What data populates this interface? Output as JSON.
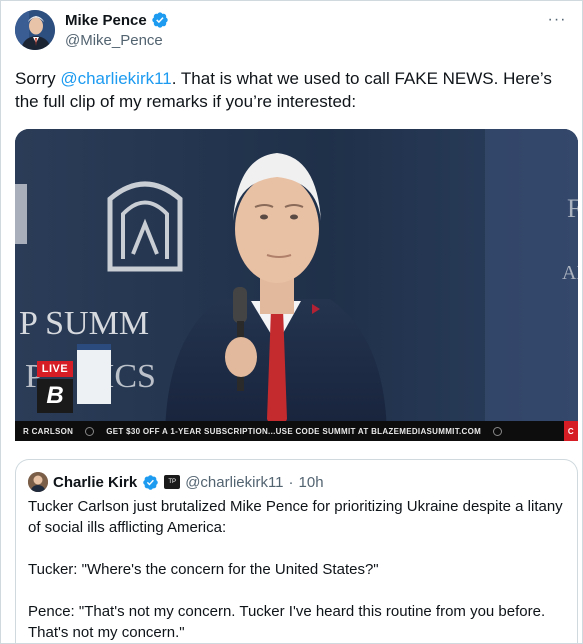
{
  "tweet": {
    "author": {
      "display_name": "Mike Pence",
      "handle": "@Mike_Pence",
      "verified": true
    },
    "text_before_mention": "Sorry ",
    "mention": "@charliekirk11",
    "text_after_mention": ". That is what we used to call FAKE NEWS. Here’s the full clip of my remarks if you’re interested:",
    "more_label": "···"
  },
  "video": {
    "backdrop_text_1": "P SUMM",
    "backdrop_text_2": "P",
    "backdrop_text_3": "ICS",
    "live_label": "LIVE",
    "logo_letter": "B",
    "ticker": {
      "name": "R CARLSON",
      "promo": "GET $30 OFF A 1-YEAR SUBSCRIPTION...USE CODE SUMMIT AT BLAZEMEDIASUMMIT.COM"
    }
  },
  "quoted_tweet": {
    "display_name": "Charlie Kirk",
    "handle": "@charliekirk11",
    "time": "10h",
    "paragraphs": [
      "Tucker Carlson just brutalized Mike Pence for prioritizing Ukraine despite a litany of social ills afflicting America:",
      "Tucker: \"Where's the concern for the United States?\"",
      "Pence: \"That's not my concern. Tucker I've heard this routine from you before. That's not my concern.\""
    ]
  },
  "colors": {
    "link": "#1d9bf0",
    "verified": "#1d9bf0",
    "border": "#cfd9de",
    "secondary_text": "#536471",
    "live_red": "#d61c24"
  },
  "icons": [
    "verified-badge-icon",
    "more-options-icon",
    "affiliate-badge-icon"
  ]
}
